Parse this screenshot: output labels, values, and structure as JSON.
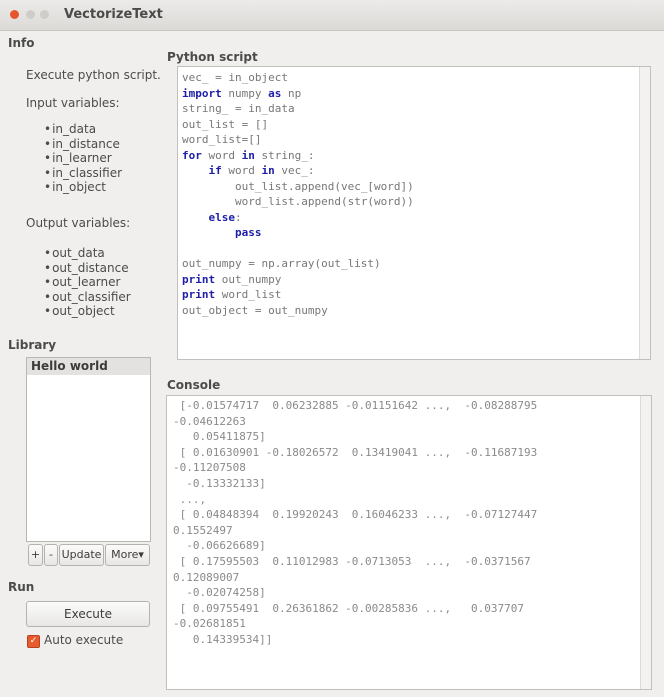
{
  "window": {
    "title": "VectorizeText"
  },
  "info": {
    "title": "Info",
    "description": "Execute python script.",
    "input_label": "Input variables:",
    "inputs": [
      "in_data",
      "in_distance",
      "in_learner",
      "in_classifier",
      "in_object"
    ],
    "output_label": "Output variables:",
    "outputs": [
      "out_data",
      "out_distance",
      "out_learner",
      "out_classifier",
      "out_object"
    ]
  },
  "library": {
    "title": "Library",
    "items": [
      "Hello world"
    ],
    "add_label": "+",
    "remove_label": "-",
    "update_label": "Update",
    "more_label": "More"
  },
  "run": {
    "title": "Run",
    "execute_label": "Execute",
    "auto_label": "Auto execute",
    "auto_checked": true
  },
  "script": {
    "title": "Python script",
    "lines": [
      [
        "",
        "",
        "vec_ = in_object"
      ],
      [
        "",
        "import",
        " numpy ",
        "as",
        " np"
      ],
      [
        "",
        "",
        "string_ = in_data"
      ],
      [
        "",
        "",
        "out_list = []"
      ],
      [
        "",
        "",
        "word_list=[]"
      ],
      [
        "",
        "for",
        " word ",
        "in",
        " string_:"
      ],
      [
        "    ",
        "if",
        " word ",
        "in",
        " vec_:"
      ],
      [
        "        ",
        "",
        "out_list.append(vec_[word])"
      ],
      [
        "        ",
        "",
        "word_list.append(str(word))"
      ],
      [
        "    ",
        "else",
        ":"
      ],
      [
        "        ",
        "pass",
        ""
      ],
      [
        "",
        "",
        ""
      ],
      [
        "",
        "",
        "out_numpy = np.array(out_list)"
      ],
      [
        "",
        "print",
        " out_numpy"
      ],
      [
        "",
        "print",
        " word_list"
      ],
      [
        "",
        "",
        "out_object = out_numpy"
      ]
    ]
  },
  "console": {
    "title": "Console",
    "lines": [
      " [-0.01574717  0.06232885 -0.01151642 ...,  -0.08288795",
      "-0.04612263",
      "   0.05411875]",
      " [ 0.01630901 -0.18026572  0.13419041 ...,  -0.11687193",
      "-0.11207508",
      "  -0.13332133]",
      " ...,",
      " [ 0.04848394  0.19920243  0.16046233 ...,  -0.07127447",
      "0.1552497",
      "  -0.06626689]",
      " [ 0.17595503  0.11012983 -0.0713053  ...,  -0.0371567",
      "0.12089007",
      "  -0.02074258]",
      " [ 0.09755491  0.26361862 -0.00285836 ...,   0.037707",
      "-0.02681851",
      "   0.14339534]]"
    ]
  },
  "colors": {
    "accent": "#e85b2e",
    "keyword": "#1e1ea8",
    "code": "#777777"
  }
}
